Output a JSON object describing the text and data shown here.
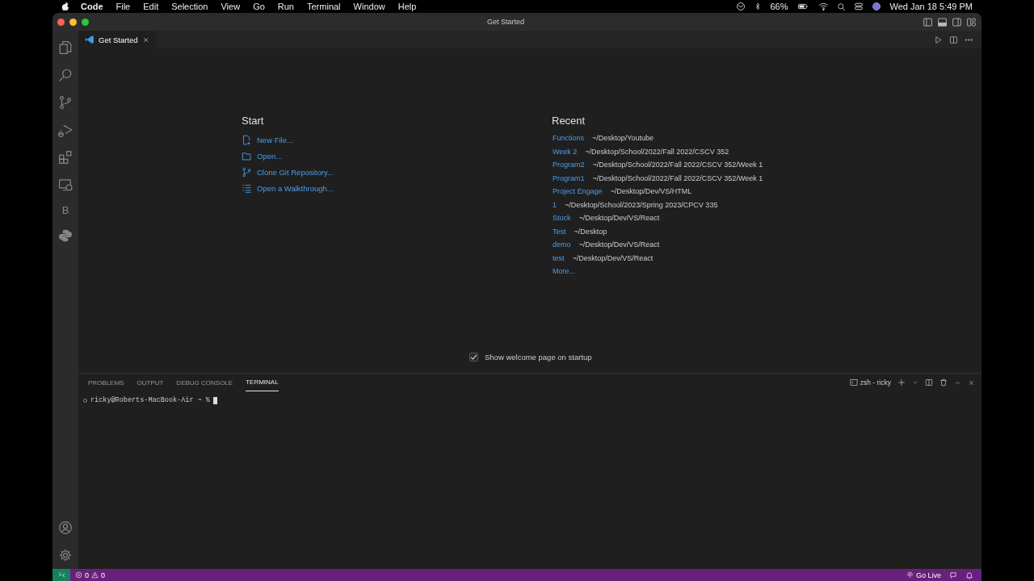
{
  "menubar": {
    "app": "Code",
    "menus": [
      "File",
      "Edit",
      "Selection",
      "View",
      "Go",
      "Run",
      "Terminal",
      "Window",
      "Help"
    ],
    "battery": "66%",
    "clock": "Wed Jan 18  5:49 PM"
  },
  "window": {
    "title": "Get Started"
  },
  "tabs": [
    {
      "label": "Get Started",
      "selected": true
    }
  ],
  "activity_bar": {
    "letter_item": "B"
  },
  "start": {
    "title": "Start",
    "items": [
      {
        "label": "New File...",
        "kind": "new-file"
      },
      {
        "label": "Open...",
        "kind": "open"
      },
      {
        "label": "Clone Git Repository...",
        "kind": "clone"
      },
      {
        "label": "Open a Walkthrough...",
        "kind": "walkthrough"
      }
    ]
  },
  "recent": {
    "title": "Recent",
    "items": [
      {
        "name": "Functions",
        "path": "~/Desktop/Youtube"
      },
      {
        "name": "Week 2",
        "path": "~/Desktop/School/2022/Fall 2022/CSCV 352"
      },
      {
        "name": "Program2",
        "path": "~/Desktop/School/2022/Fall 2022/CSCV 352/Week 1"
      },
      {
        "name": "Program1",
        "path": "~/Desktop/School/2022/Fall 2022/CSCV 352/Week 1"
      },
      {
        "name": "Project Engage",
        "path": "~/Desktop/Dev/VS/HTML"
      },
      {
        "name": "1",
        "path": "~/Desktop/School/2023/Spring 2023/CPCV 335"
      },
      {
        "name": "Stock",
        "path": "~/Desktop/Dev/VS/React"
      },
      {
        "name": "Test",
        "path": "~/Desktop"
      },
      {
        "name": "demo",
        "path": "~/Desktop/Dev/VS/React"
      },
      {
        "name": "test",
        "path": "~/Desktop/Dev/VS/React"
      }
    ],
    "more": "More..."
  },
  "welcome_checkbox": {
    "label": "Show welcome page on startup",
    "checked": true
  },
  "panel": {
    "tabs": [
      {
        "label": "PROBLEMS",
        "selected": false
      },
      {
        "label": "OUTPUT",
        "selected": false
      },
      {
        "label": "DEBUG CONSOLE",
        "selected": false
      },
      {
        "label": "TERMINAL",
        "selected": true
      }
    ],
    "terminal_name": "zsh - ricky",
    "prompt": "ricky@Roberts-MacBook-Air ~ %"
  },
  "status_bar": {
    "errors": "0",
    "warnings": "0",
    "go_live": "Go Live"
  }
}
